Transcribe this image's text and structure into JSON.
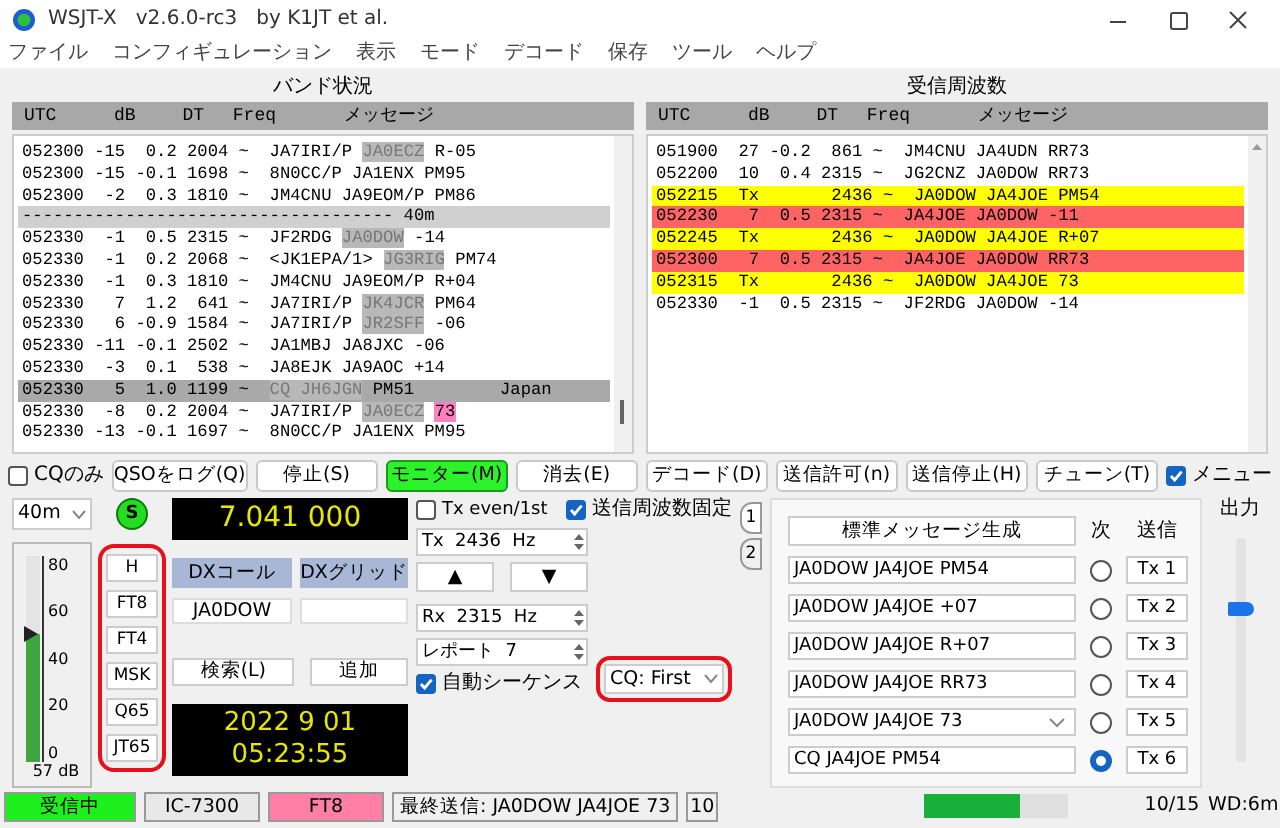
{
  "window": {
    "title": "WSJT-X   v2.6.0-rc3   by K1JT et al."
  },
  "menu": [
    "ファイル",
    "コンフィギュレーション",
    "表示",
    "モード",
    "デコード",
    "保存",
    "ツール",
    "ヘルプ"
  ],
  "band_activity": {
    "title": "バンド状況",
    "columns": [
      "UTC",
      "dB",
      "DT",
      "Freq",
      "メッセージ"
    ],
    "rows": [
      {
        "kind": "decode",
        "selected": false,
        "head": "052300 -15  0.2 2004 ~",
        "message": [
          {
            "text": "JA7IRI/P",
            "kind": "plain"
          },
          {
            "text": "JA0ECZ",
            "kind": "worked"
          },
          {
            "text": "R-05",
            "kind": "plain"
          }
        ]
      },
      {
        "kind": "decode",
        "selected": false,
        "head": "052300 -15 -0.1 1698 ~",
        "message": [
          {
            "text": "8N0CC/P JA1ENX PM95",
            "kind": "plain"
          }
        ]
      },
      {
        "kind": "decode",
        "selected": false,
        "head": "052300  -2  0.3 1810 ~",
        "message": [
          {
            "text": "JM4CNU JA9EOM/P PM86",
            "kind": "plain"
          }
        ]
      },
      {
        "kind": "separator",
        "text": "------------------------------------ 40m"
      },
      {
        "kind": "decode",
        "selected": false,
        "head": "052330  -1  0.5 2315 ~",
        "message": [
          {
            "text": "JF2RDG",
            "kind": "plain"
          },
          {
            "text": "JA0DOW",
            "kind": "worked"
          },
          {
            "text": "-14",
            "kind": "plain"
          }
        ]
      },
      {
        "kind": "decode",
        "selected": false,
        "head": "052330  -1  0.2 2068 ~",
        "message": [
          {
            "text": "<JK1EPA/1>",
            "kind": "plain"
          },
          {
            "text": "JG3RIG",
            "kind": "worked"
          },
          {
            "text": "PM74",
            "kind": "plain"
          }
        ]
      },
      {
        "kind": "decode",
        "selected": false,
        "head": "052330  -1  0.3 1810 ~",
        "message": [
          {
            "text": "JM4CNU JA9EOM/P R+04",
            "kind": "plain"
          }
        ]
      },
      {
        "kind": "decode",
        "selected": false,
        "head": "052330   7  1.2  641 ~",
        "message": [
          {
            "text": "JA7IRI/P",
            "kind": "plain"
          },
          {
            "text": "JK4JCR",
            "kind": "worked"
          },
          {
            "text": "PM64",
            "kind": "plain"
          }
        ]
      },
      {
        "kind": "decode",
        "selected": false,
        "head": "052330   6 -0.9 1584 ~",
        "message": [
          {
            "text": "JA7IRI/P",
            "kind": "plain"
          },
          {
            "text": "JR2SFF",
            "kind": "worked"
          },
          {
            "text": "-06",
            "kind": "plain"
          }
        ]
      },
      {
        "kind": "decode",
        "selected": false,
        "head": "052330 -11 -0.1 2502 ~",
        "message": [
          {
            "text": "JA1MBJ JA8JXC -06",
            "kind": "plain"
          }
        ]
      },
      {
        "kind": "decode",
        "selected": false,
        "head": "052330  -3  0.1  538 ~",
        "message": [
          {
            "text": "JA8EJK JA9AOC +14",
            "kind": "plain"
          }
        ]
      },
      {
        "kind": "decode",
        "selected": true,
        "head": "052330   5  1.0 1199 ~",
        "message": [
          {
            "text": "CQ JH6JGN",
            "kind": "cq"
          },
          {
            "text": "PM51",
            "kind": "plain"
          },
          {
            "text": "Japan",
            "kind": "country"
          }
        ]
      },
      {
        "kind": "decode",
        "selected": false,
        "head": "052330  -8  0.2 2004 ~",
        "message": [
          {
            "text": "JA7IRI/P",
            "kind": "plain"
          },
          {
            "text": "JA0ECZ",
            "kind": "worked"
          },
          {
            "text": "73",
            "kind": "final"
          }
        ]
      },
      {
        "kind": "decode",
        "selected": false,
        "head": "052330 -13 -0.1 1697 ~",
        "message": [
          {
            "text": "8N0CC/P JA1ENX PM95",
            "kind": "plain"
          }
        ]
      }
    ]
  },
  "rx_frequency": {
    "title": "受信周波数",
    "columns": [
      "UTC",
      "dB",
      "DT",
      "Freq",
      "メッセージ"
    ],
    "rows": [
      {
        "head": "051900  27 -0.2  861 ~",
        "message": [
          {
            "text": "JM4CNU JA4UDN RR73"
          }
        ]
      },
      {
        "head": "052200  10  0.4 2315 ~",
        "message": [
          {
            "text": "JG2CNZ JA0DOW RR73"
          }
        ]
      },
      {
        "head": "052215  Tx       2436 ~",
        "message": [
          {
            "text": "JA0DOW JA4JOE PM54"
          }
        ],
        "color": "#ffff00"
      },
      {
        "head": "052230   7  0.5 2315 ~",
        "message": [
          {
            "text": "JA4JOE JA0DOW -11"
          }
        ],
        "color": "#ff6464"
      },
      {
        "head": "052245  Tx       2436 ~",
        "message": [
          {
            "text": "JA0DOW JA4JOE R+07"
          }
        ],
        "color": "#ffff00"
      },
      {
        "head": "052300   7  0.5 2315 ~",
        "message": [
          {
            "text": "JA4JOE JA0DOW RR73"
          }
        ],
        "color": "#ff6464"
      },
      {
        "head": "052315  Tx       2436 ~",
        "message": [
          {
            "text": "JA0DOW JA4JOE 73"
          }
        ],
        "color": "#ffff00"
      },
      {
        "head": "052330  -1  0.5 2315 ~",
        "message": [
          {
            "text": "JF2RDG JA0DOW -14"
          }
        ]
      }
    ]
  },
  "cq_only": {
    "label": "CQのみ",
    "checked": false
  },
  "buttons": [
    {
      "label": "QSOをログ(Q)",
      "on": false
    },
    {
      "label": "停止(S)",
      "on": false
    },
    {
      "label": "モニター(M)",
      "on": true
    },
    {
      "label": "消去(E)",
      "on": false
    },
    {
      "label": "デコード(D)",
      "on": false
    },
    {
      "label": "送信許可(n)",
      "on": false
    },
    {
      "label": "送信停止(H)",
      "on": false
    },
    {
      "label": "チューン(T)",
      "on": false
    }
  ],
  "menus_toggle": {
    "label": "メニュー",
    "checked": true
  },
  "band": "40m",
  "sync_indicator": {
    "label": "S",
    "on": true
  },
  "dial_frequency": "7.041 000",
  "meter": {
    "ticks": [
      "80",
      "60",
      "40",
      "20",
      "0"
    ],
    "level": 0.62,
    "reading": "57 dB"
  },
  "modes": {
    "highlighted": true,
    "items": [
      "H",
      "FT8",
      "FT4",
      "MSK",
      "Q65",
      "JT65"
    ]
  },
  "dx": {
    "call_label": "DXコール",
    "grid_label": "DXグリッド",
    "call": "JA0DOW",
    "lookup": "検索(L)",
    "add": "追加"
  },
  "clock": {
    "date": "2022 9 01",
    "time": "05:23:55"
  },
  "tx_even": {
    "label": "Tx even/1st",
    "checked": false
  },
  "tx_freq": {
    "prefix": "Tx",
    "value": "2436",
    "unit": "Hz"
  },
  "arrows": [
    "▲",
    "▼"
  ],
  "rx_freq": {
    "prefix": "Rx",
    "value": "2315",
    "unit": "Hz"
  },
  "report": {
    "label": "レポート",
    "value": "7"
  },
  "auto_seq": {
    "label": "自動シーケンス",
    "checked": true
  },
  "hold_tx_freq": {
    "label": "送信周波数固定",
    "checked": true
  },
  "cq_mode": {
    "value": "CQ: First",
    "highlighted": true
  },
  "tabs": [
    {
      "label": "1",
      "selected": true
    },
    {
      "label": "2",
      "selected": false
    }
  ],
  "messages": {
    "generate": "標準メッセージ生成",
    "next_label": "次",
    "tx_label": "送信",
    "rows": [
      {
        "kind": "field",
        "message": "JA0DOW JA4JOE PM54",
        "selected": false,
        "tx": "Tx 1"
      },
      {
        "kind": "field",
        "message": "JA0DOW JA4JOE +07",
        "selected": false,
        "tx": "Tx 2"
      },
      {
        "kind": "field",
        "message": "JA0DOW JA4JOE R+07",
        "selected": false,
        "tx": "Tx 3"
      },
      {
        "kind": "field",
        "message": "JA0DOW JA4JOE RR73",
        "selected": false,
        "tx": "Tx 4"
      },
      {
        "kind": "combo",
        "message": "JA0DOW JA4JOE 73",
        "selected": false,
        "tx": "Tx 5"
      },
      {
        "kind": "field",
        "message": "CQ JA4JOE PM54",
        "selected": true,
        "tx": "Tx 6"
      }
    ]
  },
  "output": {
    "label": "出力",
    "level": 0.68
  },
  "status_bar": {
    "state": "受信中",
    "rig": "IC-7300",
    "mode": "FT8",
    "last_tx": "最終送信: JA0DOW JA4JOE 73",
    "count": "10",
    "progress": {
      "level": 0.67
    },
    "period": "10/15",
    "wd": "WD:6m"
  }
}
